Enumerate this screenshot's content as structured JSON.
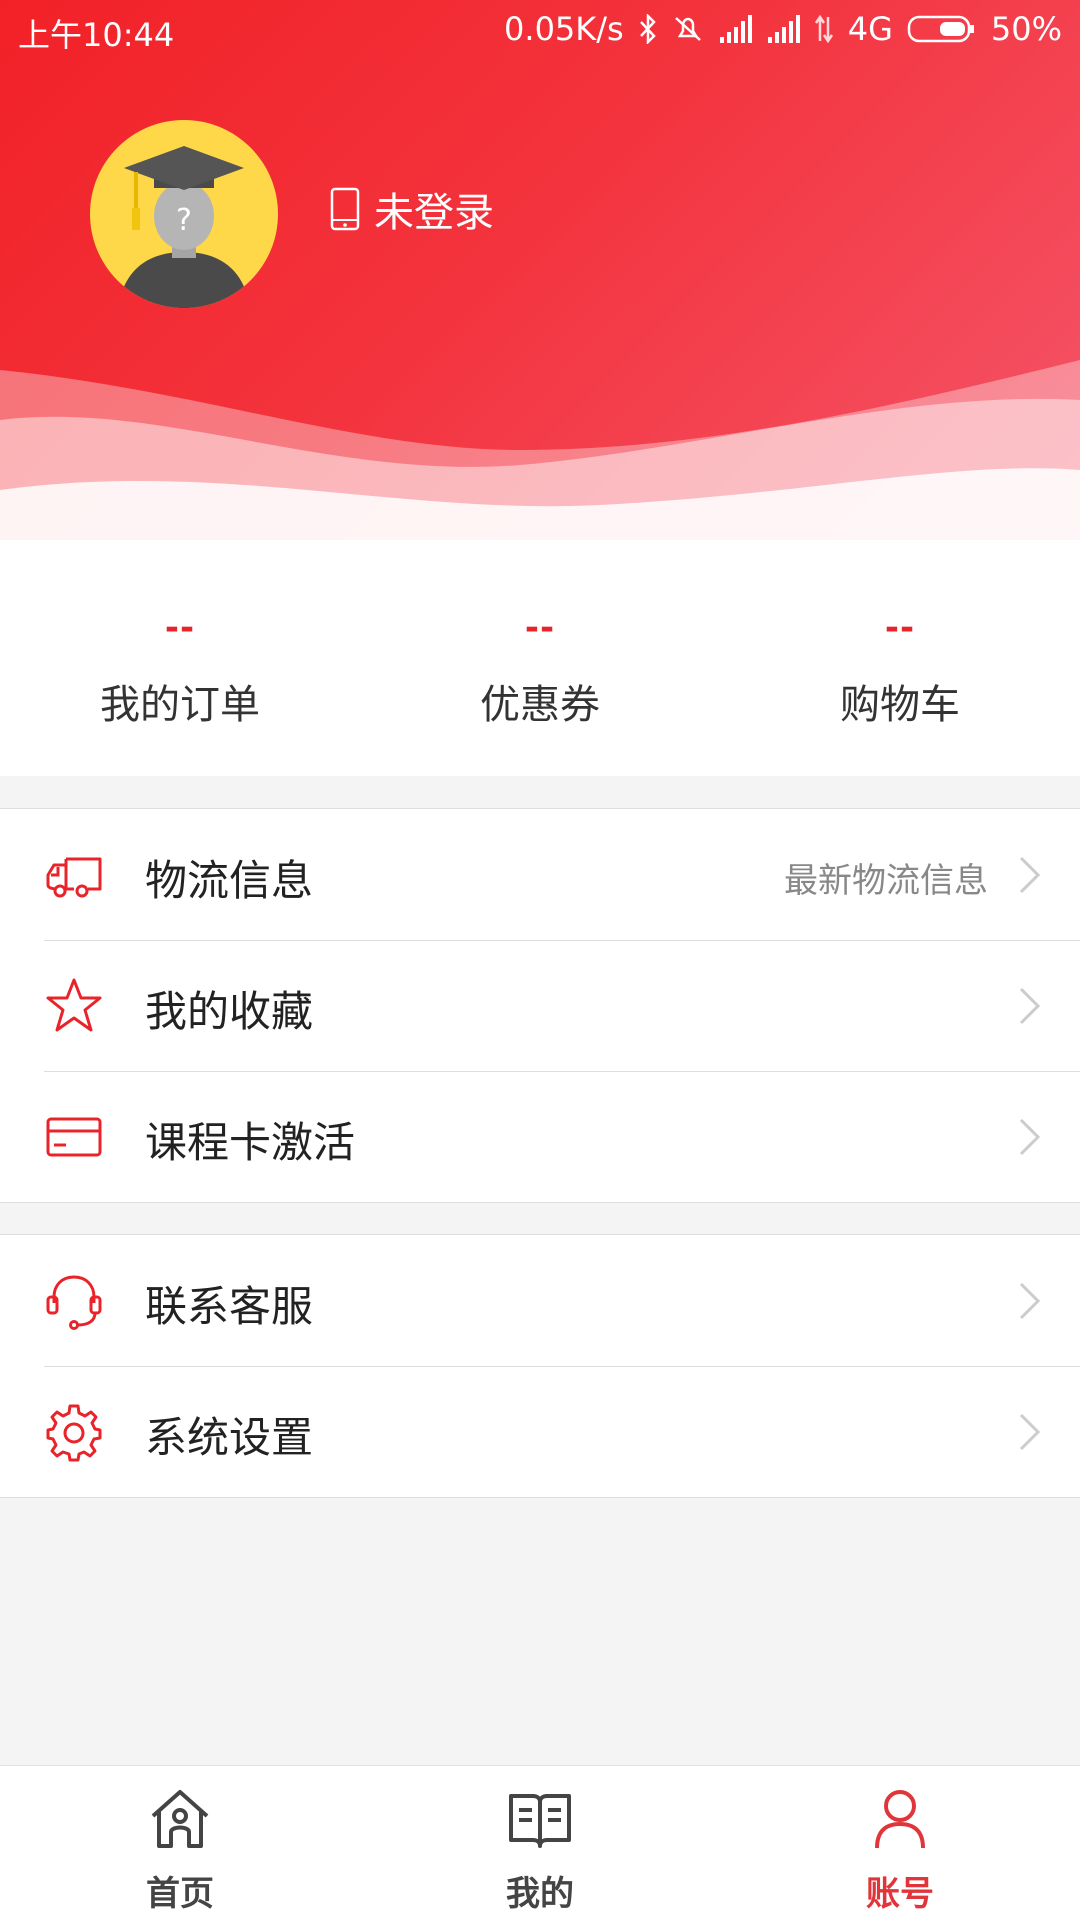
{
  "status_bar": {
    "time": "上午10:44",
    "net_speed": "0.05K/s",
    "network": "4G",
    "battery": "50%",
    "icons": [
      "bluetooth-icon",
      "mute-icon",
      "signal-icon",
      "signal-icon",
      "data-icon",
      "battery-icon"
    ]
  },
  "profile": {
    "avatar_icon": "graduate-avatar-icon",
    "login_icon": "phone-icon",
    "login_text": "未登录"
  },
  "stats": [
    {
      "value": "--",
      "label": "我的订单"
    },
    {
      "value": "--",
      "label": "优惠券"
    },
    {
      "value": "--",
      "label": "购物车"
    }
  ],
  "menu_groups": [
    [
      {
        "icon": "truck-icon",
        "title": "物流信息",
        "hint": "最新物流信息"
      },
      {
        "icon": "star-icon",
        "title": "我的收藏",
        "hint": ""
      },
      {
        "icon": "card-icon",
        "title": "课程卡激活",
        "hint": ""
      }
    ],
    [
      {
        "icon": "headset-icon",
        "title": "联系客服",
        "hint": ""
      },
      {
        "icon": "gear-icon",
        "title": "系统设置",
        "hint": ""
      }
    ]
  ],
  "tabs": [
    {
      "icon": "home-icon",
      "label": "首页",
      "active": false
    },
    {
      "icon": "book-icon",
      "label": "我的",
      "active": false
    },
    {
      "icon": "user-icon",
      "label": "账号",
      "active": true
    }
  ],
  "colors": {
    "accent": "#e8242a",
    "header_start": "#f22127",
    "header_end": "#f5566a",
    "tab_inactive": "#444444",
    "tab_active": "#e0363b"
  }
}
